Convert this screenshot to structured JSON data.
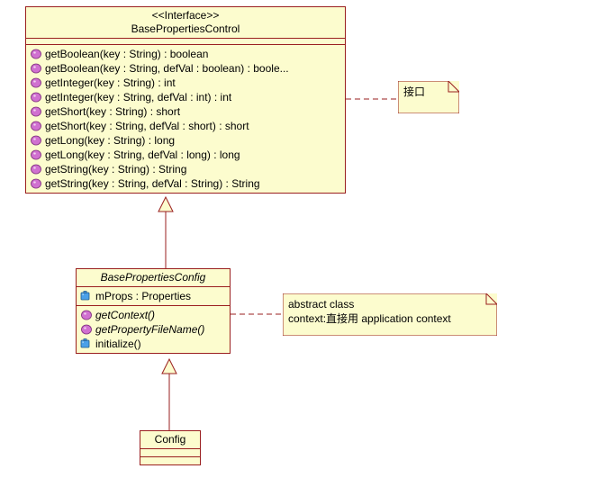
{
  "interface": {
    "stereotype": "<<Interface>>",
    "name": "BasePropertiesControl",
    "methods": [
      "getBoolean(key : String) : boolean",
      "getBoolean(key : String, defVal : boolean) : boole...",
      "getInteger(key : String) : int",
      "getInteger(key : String, defVal : int) : int",
      "getShort(key : String) : short",
      "getShort(key : String, defVal : short) : short",
      "getLong(key : String) : long",
      "getLong(key : String, defVal : long) : long",
      "getString(key : String) : String",
      "getString(key : String, defVal : String) : String"
    ]
  },
  "abstract_class": {
    "name": "BasePropertiesConfig",
    "attributes": [
      "mProps : Properties"
    ],
    "methods": [
      {
        "label": "getContext()",
        "abstract": true
      },
      {
        "label": "getPropertyFileName()",
        "abstract": true
      },
      {
        "label": "initialize()",
        "abstract": false
      }
    ]
  },
  "config_class": {
    "name": "Config"
  },
  "notes": {
    "interface_note": "接口",
    "abstract_note_line1": "abstract class",
    "abstract_note_line2": "context:直接用 application context"
  },
  "colors": {
    "fill": "#fcfcce",
    "border": "#9a1f1f"
  }
}
